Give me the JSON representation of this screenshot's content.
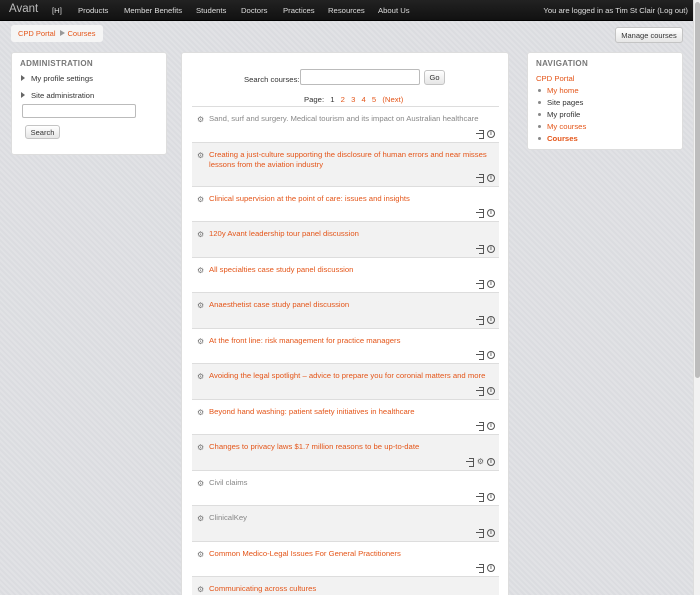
{
  "navbar": {
    "brand": "Avant",
    "menu": [
      "[H]",
      "Products",
      "Member Benefits",
      "Students",
      "Doctors",
      "Practices",
      "Resources",
      "About Us"
    ],
    "login_text": "You are logged in as Tim St Clair (Log out)"
  },
  "breadcrumb": {
    "items": [
      "CPD Portal",
      "Courses"
    ]
  },
  "manage_button": "Manage courses",
  "admin": {
    "title": "ADMINISTRATION",
    "items": [
      "My profile settings",
      "Site administration"
    ],
    "search_button": "Search"
  },
  "search": {
    "label": "Search courses:",
    "go": "Go"
  },
  "pager": {
    "label": "Page:",
    "pages": [
      "1",
      "2",
      "3",
      "4",
      "5"
    ],
    "current": "1",
    "next": "(Next)"
  },
  "courses": [
    {
      "name": "Sand, surf and surgery. Medical tourism and its impact on Australian healthcare",
      "dimmed": true
    },
    {
      "name": "Creating a just-culture supporting the disclosure of human errors and near misses lessons from the aviation industry",
      "dimmed": false
    },
    {
      "name": "Clinical supervision at the point of care: issues and insights",
      "dimmed": false
    },
    {
      "name": "120y Avant leadership tour panel discussion",
      "dimmed": false
    },
    {
      "name": "All specialties case study panel discussion",
      "dimmed": false
    },
    {
      "name": "Anaesthetist case study panel discussion",
      "dimmed": false
    },
    {
      "name": "At the front line: risk management for practice managers",
      "dimmed": false
    },
    {
      "name": "Avoiding the legal spotlight – advice to prepare you for coronial matters and more",
      "dimmed": false
    },
    {
      "name": "Beyond hand washing: patient safety initiatives in healthcare",
      "dimmed": false
    },
    {
      "name": "Changes to privacy laws $1.7 million reasons to be up-to-date",
      "dimmed": false
    },
    {
      "name": "Civil claims",
      "dimmed": true
    },
    {
      "name": "ClinicalKey",
      "dimmed": true
    },
    {
      "name": "Common Medico-Legal Issues For General Practitioners",
      "dimmed": false
    },
    {
      "name": "Communicating across cultures",
      "dimmed": false
    }
  ],
  "navigation": {
    "title": "NAVIGATION",
    "root": "CPD Portal",
    "items": [
      "My home",
      "Site pages",
      "My profile",
      "My courses",
      "Courses"
    ]
  },
  "icons": {
    "course": "course-icon",
    "enrol": "enrol-icon",
    "info": "info-icon",
    "guest": "guest-access-icon"
  },
  "colors": {
    "link": "#e4561a",
    "navbar": "#111111"
  }
}
